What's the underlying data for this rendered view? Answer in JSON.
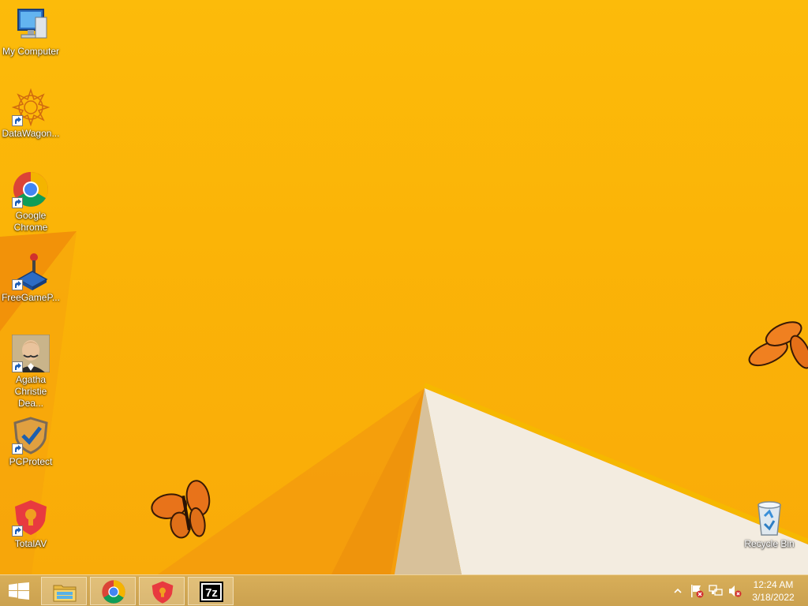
{
  "desktop": {
    "icons": [
      {
        "label": "My Computer",
        "icon": "computer-icon",
        "shortcut": false
      },
      {
        "label": "DataWagon...",
        "icon": "datawagon-icon",
        "shortcut": true
      },
      {
        "label": "Google Chrome",
        "icon": "chrome-icon",
        "shortcut": true
      },
      {
        "label": "FreeGameP...",
        "icon": "joystick-icon",
        "shortcut": true
      },
      {
        "label": "Agatha Christie Dea...",
        "icon": "agatha-christie-portrait-icon",
        "shortcut": true
      },
      {
        "label": "PCProtect",
        "icon": "pcprotect-shield-icon",
        "shortcut": true
      },
      {
        "label": "TotalAV",
        "icon": "totalav-shield-icon",
        "shortcut": true
      }
    ],
    "recycle_bin": {
      "label": "Recycle Bin",
      "icon": "recycle-bin-icon"
    }
  },
  "taskbar": {
    "start": {
      "icon": "windows-logo-icon"
    },
    "pinned": [
      {
        "name": "File Explorer",
        "icon": "file-explorer-icon"
      },
      {
        "name": "Google Chrome",
        "icon": "chrome-icon"
      },
      {
        "name": "TotalAV",
        "icon": "totalav-shield-icon"
      },
      {
        "name": "7-Zip",
        "icon": "7zip-icon"
      }
    ],
    "tray": {
      "icons": [
        "show-hidden-icons-chevron-icon",
        "action-center-flag-icon",
        "network-icon",
        "volume-muted-icon"
      ],
      "time": "12:24 AM",
      "date": "3/18/2022"
    }
  },
  "colors": {
    "wallpaper": "#fbb407",
    "wallpaper_light_plane": "#f3ece0",
    "taskbar": "#d0a24c"
  }
}
